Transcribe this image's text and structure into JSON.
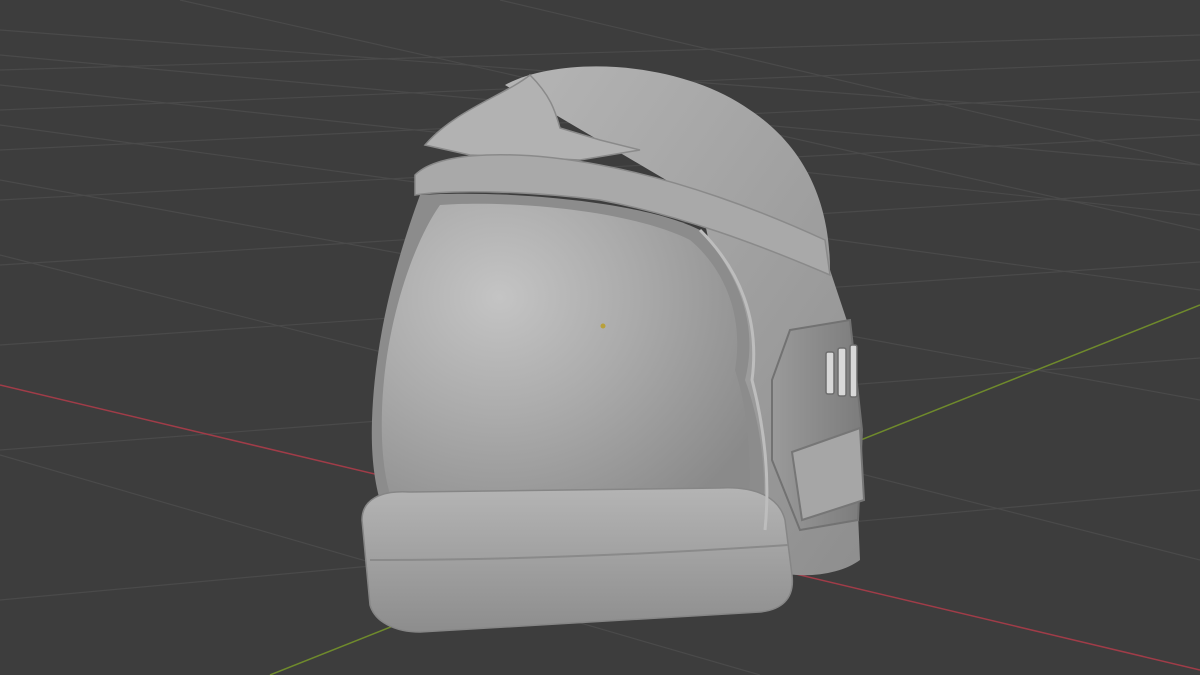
{
  "viewport": {
    "view": "3D Viewport",
    "shading": "solid",
    "background_color": "#3d3d3d",
    "grid_color": "#4a4a4a",
    "x_axis_color": "#a03c48",
    "y_axis_color": "#6f8a2c",
    "object_origin_color": "#b8a03a",
    "model_color": "#a8a8a8"
  },
  "scene": {
    "object_name": "helmet"
  }
}
